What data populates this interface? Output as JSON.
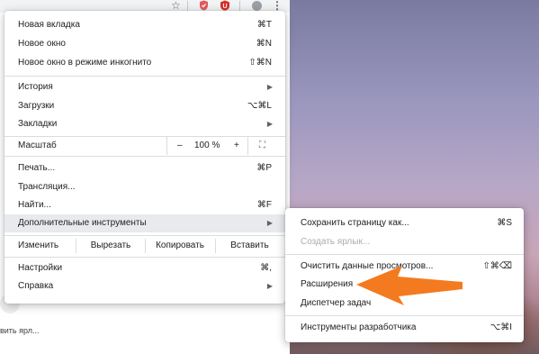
{
  "toolbar": {
    "icons": [
      "star-icon",
      "shield-extension-icon",
      "red-extension-icon",
      "profile-icon",
      "kebab-menu-icon"
    ],
    "star_glyph": "☆",
    "kebab_glyph": "⋮"
  },
  "page": {
    "partial_text": "вить ярл..."
  },
  "menu": {
    "new_tab": {
      "label": "Новая вкладка",
      "shortcut": "⌘T"
    },
    "new_window": {
      "label": "Новое окно",
      "shortcut": "⌘N"
    },
    "incognito": {
      "label": "Новое окно в режиме инкогнито",
      "shortcut": "⇧⌘N"
    },
    "history": {
      "label": "История"
    },
    "downloads": {
      "label": "Загрузки",
      "shortcut": "⌥⌘L"
    },
    "bookmarks": {
      "label": "Закладки"
    },
    "zoom": {
      "label": "Масштаб",
      "minus": "–",
      "value": "100 %",
      "plus": "+",
      "fullscreen": "⛶"
    },
    "print": {
      "label": "Печать...",
      "shortcut": "⌘P"
    },
    "cast": {
      "label": "Трансляция..."
    },
    "find": {
      "label": "Найти...",
      "shortcut": "⌘F"
    },
    "more_tools": {
      "label": "Дополнительные инструменты"
    },
    "edit": {
      "label": "Изменить",
      "cut": "Вырезать",
      "copy": "Копировать",
      "paste": "Вставить"
    },
    "settings": {
      "label": "Настройки",
      "shortcut": "⌘,"
    },
    "help": {
      "label": "Справка"
    },
    "submenu_arrow": "▶"
  },
  "submenu": {
    "save_page": {
      "label": "Сохранить страницу как...",
      "shortcut": "⌘S"
    },
    "create_shortcut": {
      "label": "Создать ярлык..."
    },
    "clear_data": {
      "label": "Очистить данные просмотров...",
      "shortcut": "⇧⌘⌫"
    },
    "extensions": {
      "label": "Расширения"
    },
    "task_manager": {
      "label": "Диспетчер задач"
    },
    "dev_tools": {
      "label": "Инструменты разработчика",
      "shortcut": "⌥⌘I"
    }
  },
  "colors": {
    "annotation_arrow": "#f47a1f",
    "hover_row": "#e8eaed",
    "disabled_text": "#a8abaf"
  }
}
